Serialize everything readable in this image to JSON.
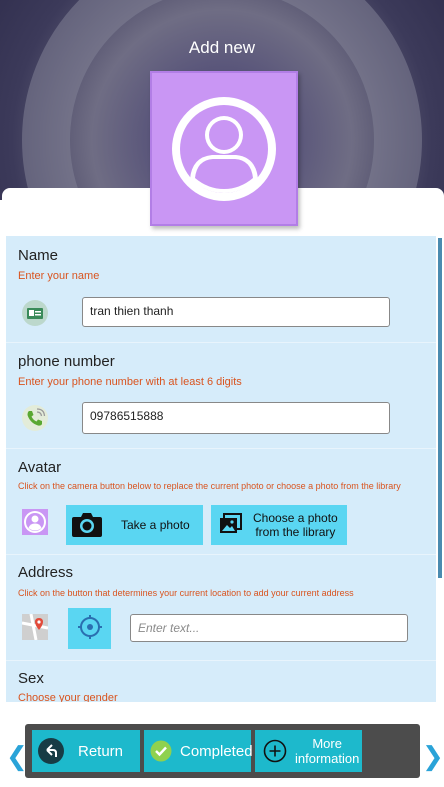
{
  "header": {
    "title": "Add new"
  },
  "form": {
    "name": {
      "label": "Name",
      "hint": "Enter your name",
      "value": "tran thien thanh"
    },
    "phone": {
      "label": "phone number",
      "hint": "Enter your phone number with at least 6 digits",
      "value": "09786515888"
    },
    "avatar": {
      "label": "Avatar",
      "hint": "Click on the camera button below to replace the current photo or choose a photo from the library",
      "take_photo": "Take a photo",
      "choose_line1": "Choose a photo",
      "choose_line2": "from the library"
    },
    "address": {
      "label": "Address",
      "hint": "Click on the button that determines your current location to add your current address",
      "placeholder": "Enter text..."
    },
    "sex": {
      "label": "Sex",
      "hint": "Choose your gender"
    }
  },
  "bottom": {
    "return_label": "Return",
    "completed_label": "Completed",
    "more_line1": "More",
    "more_line2": "information"
  },
  "colors": {
    "accent": "#1db9cc",
    "hint": "#d9541f",
    "form_bg": "#d6ecfa",
    "avatar_bg": "#c996f4"
  }
}
